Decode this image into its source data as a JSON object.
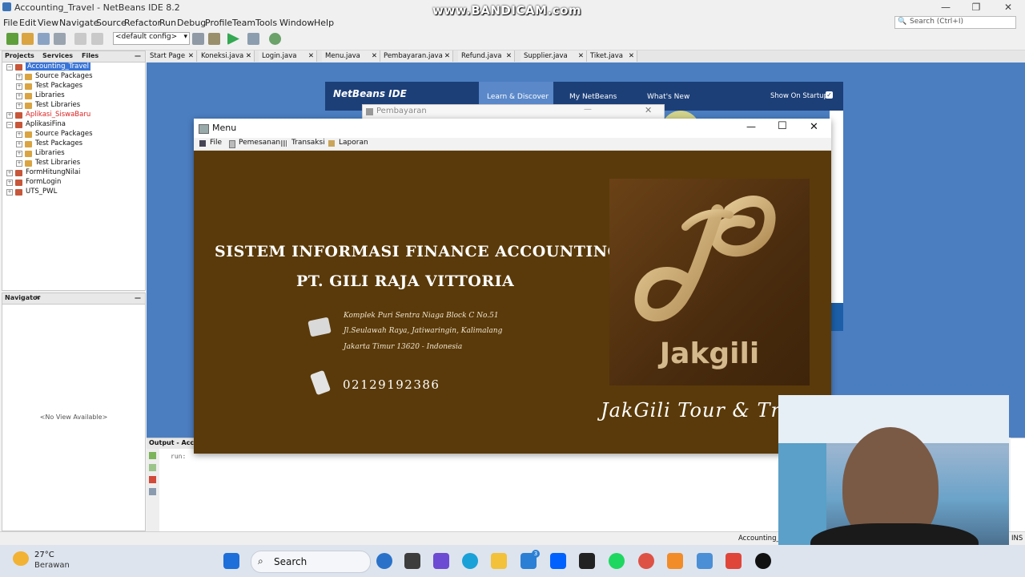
{
  "window": {
    "title": "Accounting_Travel - NetBeans IDE 8.2"
  },
  "watermark": "www.BANDICAM.com",
  "menubar": [
    "File",
    "Edit",
    "View",
    "Navigate",
    "Source",
    "Refactor",
    "Run",
    "Debug",
    "Profile",
    "Team",
    "Tools",
    "Window",
    "Help"
  ],
  "search": {
    "placeholder": "Search (Ctrl+I)"
  },
  "toolbar": {
    "config": "<default config>"
  },
  "projects_panel": {
    "tabs": [
      "Projects",
      "Services",
      "Files"
    ],
    "tree": [
      {
        "label": "Accounting_Travel",
        "level": 0,
        "selected": true
      },
      {
        "label": "Source Packages",
        "level": 1
      },
      {
        "label": "Test Packages",
        "level": 1
      },
      {
        "label": "Libraries",
        "level": 1
      },
      {
        "label": "Test Libraries",
        "level": 1
      },
      {
        "label": "Aplikasi_SiswaBaru",
        "level": 0,
        "error": true
      },
      {
        "label": "AplikasiFina",
        "level": 0
      },
      {
        "label": "Source Packages",
        "level": 1
      },
      {
        "label": "Test Packages",
        "level": 1
      },
      {
        "label": "Libraries",
        "level": 1
      },
      {
        "label": "Test Libraries",
        "level": 1
      },
      {
        "label": "FormHitungNilai",
        "level": 0
      },
      {
        "label": "FormLogin",
        "level": 0
      },
      {
        "label": "UTS_PWL",
        "level": 0
      }
    ]
  },
  "navigator_panel": {
    "title": "Navigator",
    "empty": "<No View Available>"
  },
  "editor_tabs": [
    "Start Page",
    "Koneksi.java",
    "Login.java",
    "Menu.java",
    "Pembayaran.java",
    "Refund.java",
    "Supplier.java",
    "Tiket.java"
  ],
  "start_page": {
    "brand": "NetBeans IDE",
    "tabs": [
      "Learn & Discover",
      "My NetBeans",
      "What's New"
    ],
    "show_on_startup": "Show On Startup"
  },
  "output": {
    "title": "Output - Accou",
    "text": "run:"
  },
  "status": {
    "project": "Accounting_T",
    "mode": "INS"
  },
  "pembayaran_window": {
    "title": "Pembayaran"
  },
  "menu_window": {
    "title": "Menu",
    "menus": [
      "File",
      "Pemesanan",
      "Transaksi",
      "Laporan"
    ],
    "heading1": "SISTEM INFORMASI FINANCE ACCOUNTING",
    "heading2": "PT. GILI RAJA VITTORIA",
    "address": [
      "Komplek Puri Sentra Niaga Block C No.51",
      "Jl.Seulawah Raya, Jatiwaringin, Kalimalang",
      "Jakarta Timur 13620 - Indonesia"
    ],
    "phone": "02129192386",
    "logo_text": "Jakgili",
    "tagline": "JakGili Tour & Tr"
  },
  "taskbar": {
    "temperature": "27°C",
    "weather": "Berawan",
    "search": "Search",
    "badge": "3"
  }
}
